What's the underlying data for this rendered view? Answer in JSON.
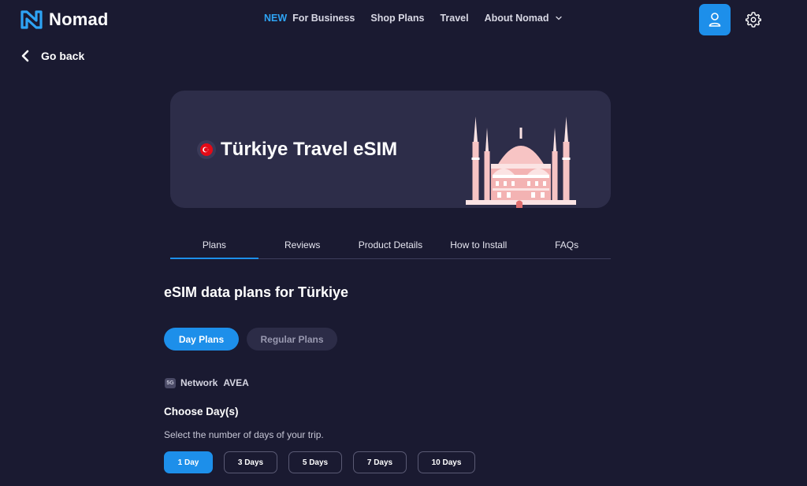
{
  "brand": {
    "name": "Nomad"
  },
  "nav": {
    "new_badge": "NEW",
    "items": [
      {
        "label": "For Business"
      },
      {
        "label": "Shop Plans"
      },
      {
        "label": "Travel"
      },
      {
        "label": "About Nomad"
      }
    ]
  },
  "go_back": "Go back",
  "hero": {
    "title": "Türkiye Travel eSIM"
  },
  "tabs": [
    {
      "label": "Plans",
      "active": true
    },
    {
      "label": "Reviews"
    },
    {
      "label": "Product Details"
    },
    {
      "label": "How to Install"
    },
    {
      "label": "FAQs"
    }
  ],
  "plans_section": {
    "title": "eSIM data plans for Türkiye",
    "toggle": [
      {
        "label": "Day Plans",
        "active": true
      },
      {
        "label": "Regular Plans"
      }
    ],
    "network": {
      "badge": "5G",
      "label": "Network",
      "value": "AVEA"
    },
    "choose_title": "Choose Day(s)",
    "choose_subtitle": "Select the number of days of your trip.",
    "days": [
      {
        "label": "1 Day",
        "active": true
      },
      {
        "label": "3 Days"
      },
      {
        "label": "5 Days"
      },
      {
        "label": "7 Days"
      },
      {
        "label": "10 Days"
      }
    ]
  },
  "colors": {
    "background": "#1a1a31",
    "accent": "#1d8fea",
    "card": "#2d2d49",
    "mosque": "#f7c4c4"
  }
}
